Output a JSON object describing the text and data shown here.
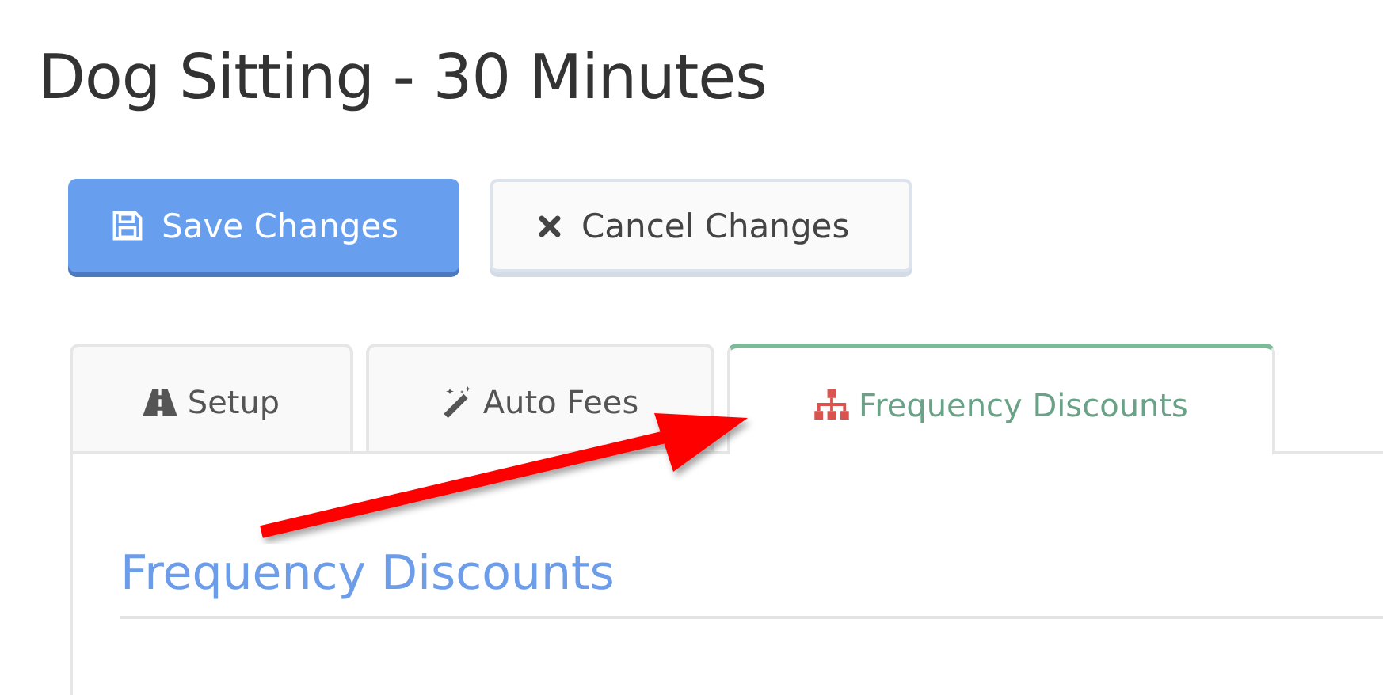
{
  "page": {
    "title": "Dog Sitting - 30 Minutes"
  },
  "buttons": [
    {
      "label": "Save Changes",
      "kind": "primary"
    },
    {
      "label": "Cancel Changes",
      "kind": "secondary"
    }
  ],
  "tabs": [
    {
      "label": "Setup",
      "selected": false
    },
    {
      "label": "Auto Fees",
      "selected": false
    },
    {
      "label": "Frequency Discounts",
      "selected": true
    }
  ],
  "panel": {
    "heading": "Frequency Discounts"
  },
  "annotations": [
    {
      "kind": "arrow"
    }
  ]
}
